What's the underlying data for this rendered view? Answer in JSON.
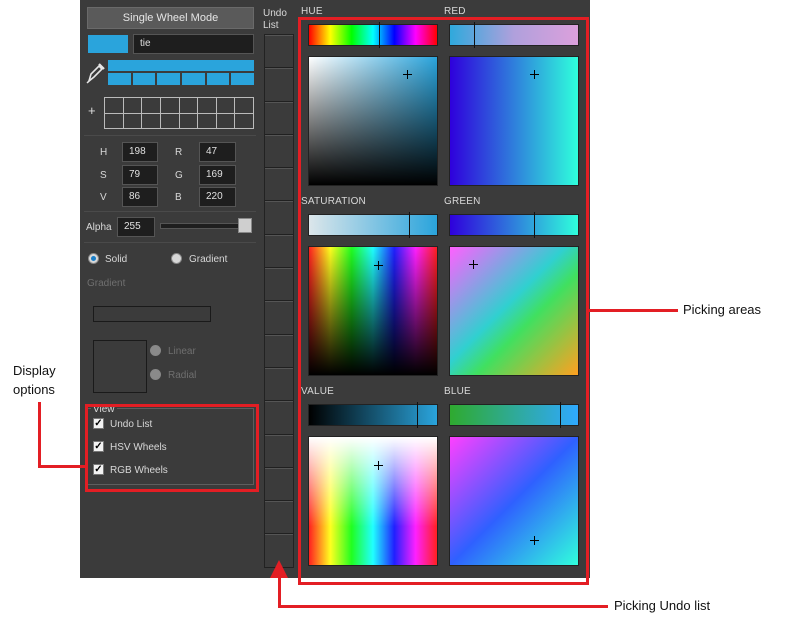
{
  "mode_button": "Single Wheel Mode",
  "color_name": "tie",
  "current_color": "#2aa4dc",
  "hsv": [
    {
      "k": "H",
      "v": "198"
    },
    {
      "k": "S",
      "v": "79"
    },
    {
      "k": "V",
      "v": "86"
    }
  ],
  "rgb": [
    {
      "k": "R",
      "v": "47"
    },
    {
      "k": "G",
      "v": "169"
    },
    {
      "k": "B",
      "v": "220"
    }
  ],
  "alpha": {
    "label": "Alpha",
    "value": "255"
  },
  "fill": {
    "solid": "Solid",
    "gradient": "Gradient",
    "gradient_header": "Gradient",
    "linear": "Linear",
    "radial": "Radial"
  },
  "view": {
    "title": "View",
    "undo_list": "Undo List",
    "hsv_wheels": "HSV Wheels",
    "rgb_wheels": "RGB Wheels"
  },
  "undo_header": "Undo\nList",
  "wheels": {
    "hue": "HUE",
    "red": "RED",
    "saturation": "SATURATION",
    "green": "GREEN",
    "value": "VALUE",
    "blue": "BLUE"
  },
  "annotations": {
    "picking_areas": "Picking areas",
    "display_options": "Display\noptions",
    "picking_undo": "Picking Undo list"
  },
  "colors": {
    "accent": "#2aa4dc",
    "callout": "#e31e24",
    "panel": "#3b3b3b"
  }
}
